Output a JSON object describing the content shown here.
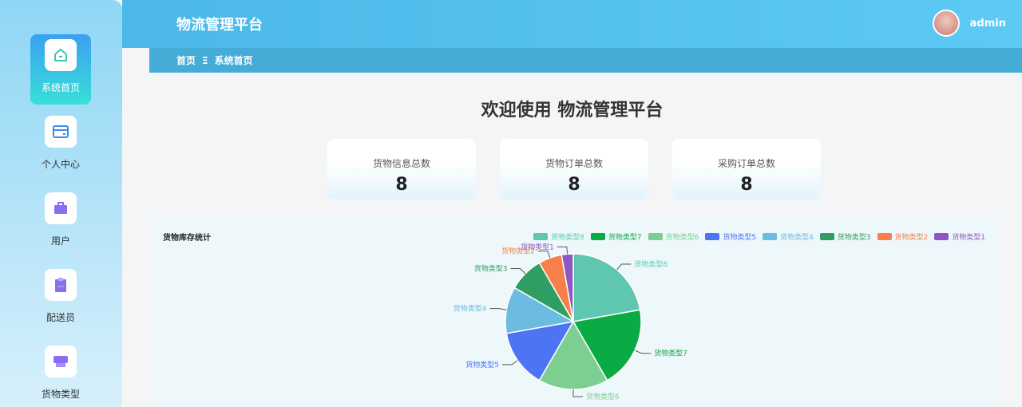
{
  "sidebar": {
    "items": [
      {
        "label": "系统首页",
        "icon": "home-icon"
      },
      {
        "label": "个人中心",
        "icon": "wallet-icon"
      },
      {
        "label": "用户",
        "icon": "briefcase-icon"
      },
      {
        "label": "配送员",
        "icon": "clipboard-icon"
      },
      {
        "label": "货物类型",
        "icon": "box-icon"
      }
    ]
  },
  "header": {
    "title": "物流管理平台",
    "user": "admin"
  },
  "breadcrumb": {
    "home": "首页",
    "sep": "Ξ",
    "current": "系统首页"
  },
  "main": {
    "welcome": "欢迎使用 物流管理平台",
    "cards": [
      {
        "title": "货物信息总数",
        "value": "8"
      },
      {
        "title": "货物订单总数",
        "value": "8"
      },
      {
        "title": "采购订单总数",
        "value": "8"
      }
    ]
  },
  "chart_data": {
    "type": "pie",
    "title": "货物库存统计",
    "legend_position": "top-right",
    "categories": [
      "货物类型8",
      "货物类型7",
      "货物类型6",
      "货物类型5",
      "货物类型4",
      "货物类型3",
      "货物类型2",
      "货物类型1"
    ],
    "values": [
      8,
      7,
      6,
      5,
      4,
      3,
      2,
      1
    ],
    "colors": [
      "#5fc7b0",
      "#0aab45",
      "#7ccf91",
      "#4d74f5",
      "#6cbbe0",
      "#2f9e63",
      "#f77f49",
      "#8e58c2"
    ]
  }
}
